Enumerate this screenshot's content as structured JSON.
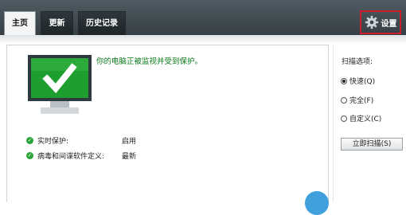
{
  "tabs": [
    {
      "label": "主页"
    },
    {
      "label": "更新"
    },
    {
      "label": "历史记录"
    }
  ],
  "settings": {
    "label": "设置"
  },
  "main": {
    "headline": "你的电脑正被监视并受到保护。",
    "status": [
      {
        "label": "实时保护:",
        "value": "启用"
      },
      {
        "label": "病毒和间谍软件定义:",
        "value": "最新"
      }
    ]
  },
  "scan": {
    "title": "扫描选项:",
    "options": [
      {
        "label": "快速(Q)",
        "selected": true
      },
      {
        "label": "完全(F)",
        "selected": false
      },
      {
        "label": "自定义(C)",
        "selected": false
      }
    ],
    "button": "立即扫描(S)"
  },
  "colors": {
    "protected_green": "#1e9e2e",
    "highlight_red": "#c8202a",
    "header_dark": "#363f45"
  },
  "icons": {
    "settings": "gear-icon",
    "status": "checkmark-icon",
    "monitor": "monitor-check-icon"
  }
}
